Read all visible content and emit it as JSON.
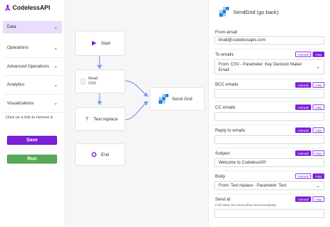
{
  "brand": {
    "name": "CodelessAPI"
  },
  "sidebar": {
    "items": [
      {
        "label": "Data"
      },
      {
        "label": "Operations"
      },
      {
        "label": "Advanced Operations"
      },
      {
        "label": "Analytics"
      },
      {
        "label": "Visualizations"
      }
    ],
    "hint": "Click on a link to remove it.",
    "save_label": "Save",
    "run_label": "Run"
  },
  "canvas": {
    "nodes": {
      "start": "Start",
      "read_csv_line1": "Read",
      "read_csv_line2": "CSV",
      "text_replace": "Text replace",
      "end": "End",
      "send_grid": "Send Grid"
    }
  },
  "panel": {
    "title": "SendGrid (go back)",
    "toggle": {
      "manual": "manual",
      "map": "map"
    },
    "fields": {
      "from_email": {
        "label": "From email",
        "value": "khalil@codelessapis.com"
      },
      "to_emails": {
        "label": "To emails",
        "value_line1": "From: CSV - Parameter: Key Decision Maker",
        "value_line2": "Email"
      },
      "bcc_emails": {
        "label": "BCC emails",
        "value": ""
      },
      "cc_emails": {
        "label": "CC emails",
        "value": ""
      },
      "reply_to": {
        "label": "Reply to emails",
        "value": ""
      },
      "subject": {
        "label": "Subject",
        "value": "Welcome to CodelessAPI"
      },
      "body": {
        "label": "Body",
        "value": "From: Text replace - Parameter: Text"
      },
      "send_at": {
        "label": "Send at",
        "hint": "If left blank, the email will be sent immediately.",
        "value": ""
      }
    }
  },
  "colors": {
    "accent": "#7a1fd6",
    "run": "#57a957",
    "active_bg": "#e9ddfb",
    "edge": "#7a9be8"
  }
}
